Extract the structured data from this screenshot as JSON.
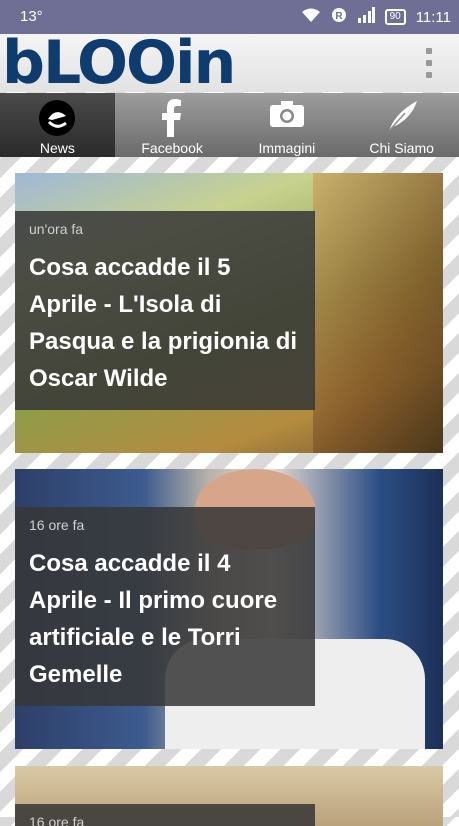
{
  "status": {
    "temperature": "13°",
    "battery": "90",
    "time": "11:11"
  },
  "app": {
    "logo": "bLOOin"
  },
  "tabs": [
    {
      "label": "News",
      "icon": "news-icon",
      "active": true
    },
    {
      "label": "Facebook",
      "icon": "facebook-icon",
      "active": false
    },
    {
      "label": "Immagini",
      "icon": "camera-icon",
      "active": false
    },
    {
      "label": "Chi Siamo",
      "icon": "feather-icon",
      "active": false
    }
  ],
  "articles": [
    {
      "time": "un'ora fa",
      "title": "Cosa accadde il 5 Aprile - L'Isola di Pasqua e la prigionia di Oscar Wilde"
    },
    {
      "time": "16 ore fa",
      "title": "Cosa accadde il 4 Aprile - Il primo cuore artificiale e le Torri Gemelle"
    },
    {
      "time": "16 ore fa",
      "title": ""
    }
  ]
}
